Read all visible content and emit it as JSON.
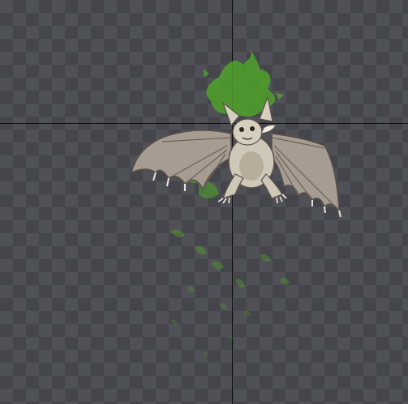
{
  "canvas": {
    "checker_light": "#505057",
    "checker_dark": "#45454b",
    "guide_color": "#111114"
  },
  "sprite": {
    "icon": "bat-creature-sprite",
    "effect": "green-poison-splatter",
    "effect_color": "#4fa22a",
    "body_color": "#cfc7b8",
    "wing_color": "#a69c92"
  }
}
